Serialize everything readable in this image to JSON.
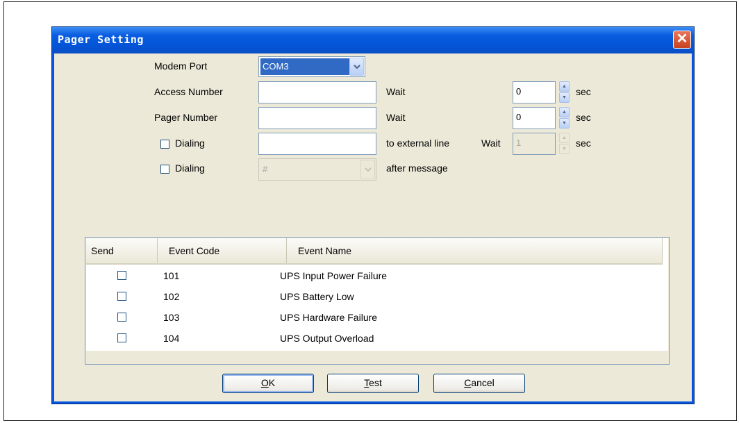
{
  "dialog": {
    "title": "Pager Setting",
    "close_glyph": "✕"
  },
  "form": {
    "modem_port_label": "Modem Port",
    "modem_port_value": "COM3",
    "access_number_label": "Access Number",
    "access_number_value": "",
    "access_wait_label": "Wait",
    "access_wait_value": "0",
    "access_wait_unit": "sec",
    "pager_number_label": "Pager Number",
    "pager_number_value": "",
    "pager_wait_label": "Wait",
    "pager_wait_value": "0",
    "pager_wait_unit": "sec",
    "dialing1_label": "Dialing",
    "dialing1_checked": false,
    "dialing1_value": "",
    "dialing1_suffix": "to external line",
    "dialing1_wait_label": "Wait",
    "dialing1_wait_value": "1",
    "dialing1_wait_unit": "sec",
    "dialing2_label": "Dialing",
    "dialing2_checked": false,
    "dialing2_value": "#",
    "dialing2_suffix": "after message"
  },
  "table": {
    "columns": [
      "Send",
      "Event Code",
      "Event Name"
    ],
    "rows": [
      {
        "send": false,
        "code": "101",
        "name": "UPS Input Power Failure"
      },
      {
        "send": false,
        "code": "102",
        "name": "UPS Battery Low"
      },
      {
        "send": false,
        "code": "103",
        "name": "UPS Hardware Failure"
      },
      {
        "send": false,
        "code": "104",
        "name": "UPS Output Overload"
      }
    ]
  },
  "buttons": {
    "ok": {
      "mnemonic": "O",
      "rest": "K"
    },
    "test": {
      "mnemonic": "T",
      "rest": "est"
    },
    "cancel": {
      "mnemonic": "C",
      "rest": "ancel"
    }
  },
  "colors": {
    "titlebar": "#0454d7",
    "client": "#ece9d8",
    "border": "#7f9db9"
  }
}
